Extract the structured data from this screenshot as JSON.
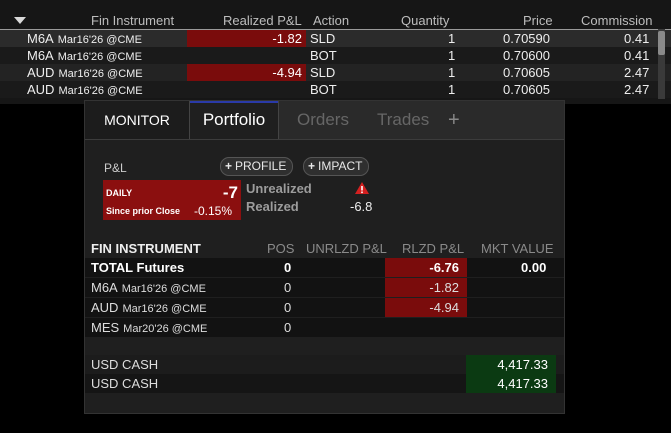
{
  "blotter": {
    "columns": [
      "Fin Instrument",
      "Realized P&L",
      "Action",
      "Quantity",
      "Price",
      "Commission"
    ],
    "rows": [
      {
        "symbol": "M6A",
        "expiry": "Mar16'26 @CME",
        "realized_pnl": "-1.82",
        "action": "SLD",
        "quantity": "1",
        "price": "0.70590",
        "commission": "0.41"
      },
      {
        "symbol": "M6A",
        "expiry": "Mar16'26 @CME",
        "realized_pnl": "",
        "action": "BOT",
        "quantity": "1",
        "price": "0.70600",
        "commission": "0.41"
      },
      {
        "symbol": "AUD",
        "expiry": "Mar16'26 @CME",
        "realized_pnl": "-4.94",
        "action": "SLD",
        "quantity": "1",
        "price": "0.70605",
        "commission": "2.47"
      },
      {
        "symbol": "AUD",
        "expiry": "Mar16'26 @CME",
        "realized_pnl": "",
        "action": "BOT",
        "quantity": "1",
        "price": "0.70605",
        "commission": "2.47"
      }
    ]
  },
  "tabs": [
    "MONITOR",
    "Portfolio",
    "Orders",
    "Trades",
    "+"
  ],
  "pnl": {
    "label": "P&L",
    "profile_btn": "PROFILE",
    "impact_btn": "IMPACT",
    "daily_label": "DAILY",
    "daily_value": "-7",
    "since_prior_label": "Since prior Close",
    "since_prior_value": "-0.15%",
    "unrealized_label": "Unrealized",
    "realized_label": "Realized",
    "realized_value": "-6.8"
  },
  "positions": {
    "headers": [
      "FIN INSTRUMENT",
      "POS",
      "UNRLZD P&L",
      "RLZD P&L",
      "MKT VALUE"
    ],
    "total": {
      "name": "TOTAL Futures",
      "pos": "0",
      "rlzd": "-6.76",
      "mkt": "0.00"
    },
    "rows": [
      {
        "symbol": "M6A",
        "expiry": "Mar16'26 @CME",
        "pos": "0",
        "rlzd": "-1.82"
      },
      {
        "symbol": "AUD",
        "expiry": "Mar16'26 @CME",
        "pos": "0",
        "rlzd": "-4.94"
      },
      {
        "symbol": "MES",
        "expiry": "Mar20'26 @CME",
        "pos": "0",
        "rlzd": ""
      }
    ],
    "cash": [
      {
        "name": "USD CASH",
        "mkt": "4,417.33"
      },
      {
        "name": "USD CASH",
        "mkt": "4,417.33"
      }
    ]
  },
  "colors": {
    "loss": "#7a0c0c",
    "gain": "#0b3a12",
    "accent": "#2a3aa8"
  },
  "icons": {
    "warning": "warning-icon",
    "menu": "caret-down-icon"
  }
}
